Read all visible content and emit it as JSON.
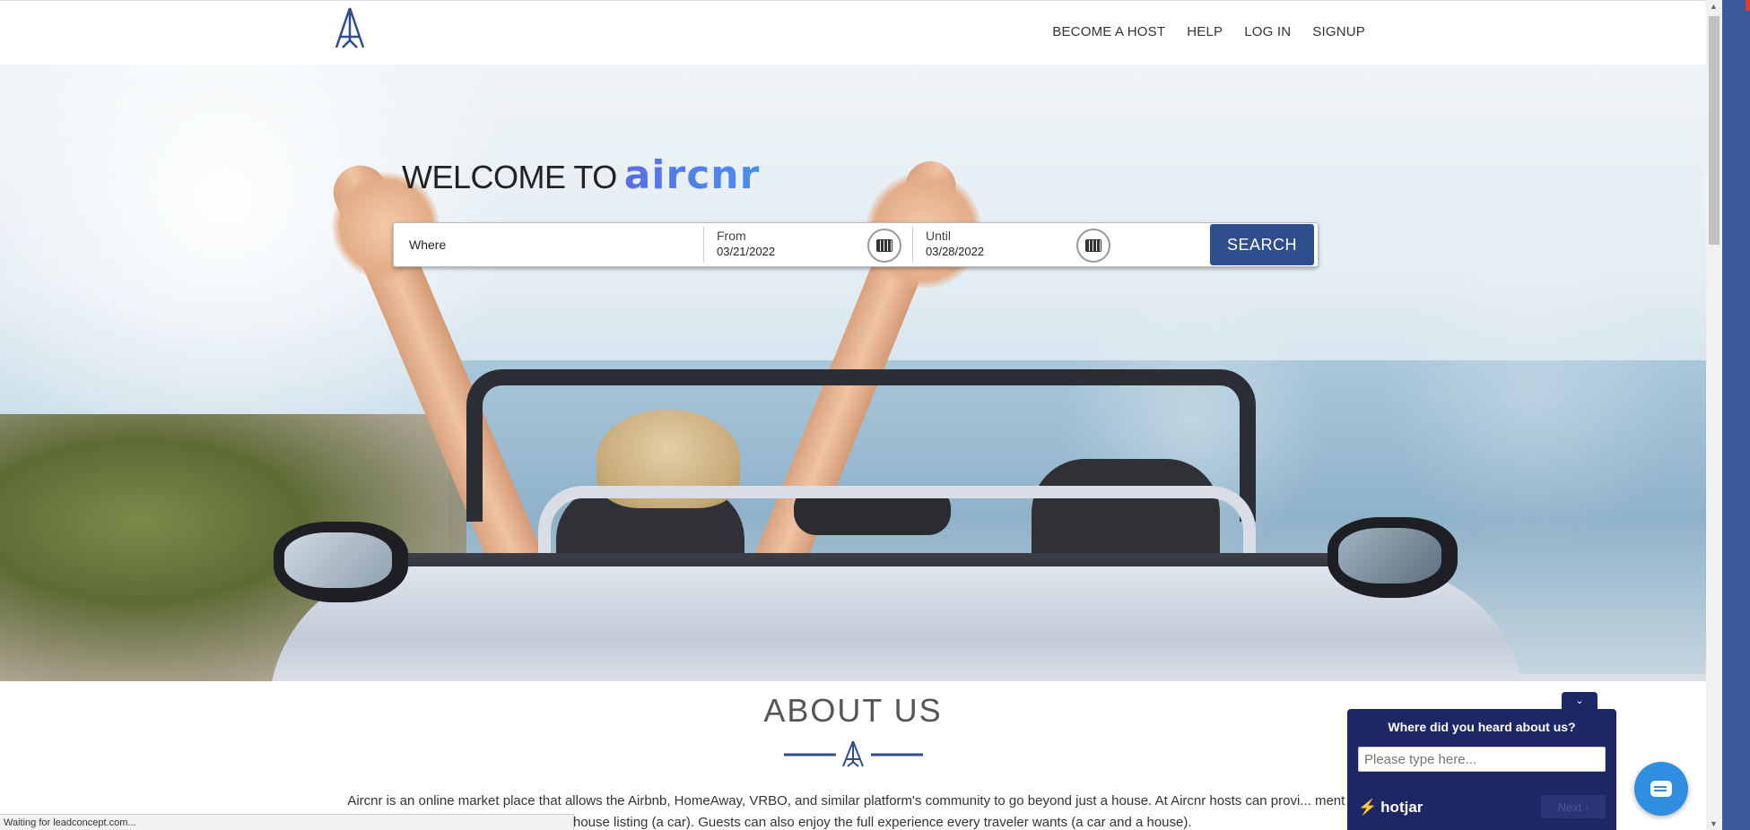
{
  "header": {
    "nav": [
      {
        "label": "BECOME A HOST"
      },
      {
        "label": "HELP"
      },
      {
        "label": "LOG IN"
      },
      {
        "label": "SIGNUP"
      }
    ]
  },
  "hero": {
    "welcome_prefix": "WELCOME TO",
    "brand": "aircnr",
    "search": {
      "where_placeholder": "Where",
      "from_label": "From",
      "from_value": "03/21/2022",
      "until_label": "Until",
      "until_value": "03/28/2022",
      "search_label": "SEARCH"
    }
  },
  "about": {
    "title": "ABOUT US",
    "text": "Aircnr is an online market place that allows the Airbnb, HomeAway, VRBO, and similar platform's community to go beyond just a house. At Aircnr hosts can provi... ment their Airbnb house listing (a car). Guests can also enjoy the full experience every traveler wants (a car and a house)."
  },
  "hotjar": {
    "question": "Where did you heard about us?",
    "placeholder": "Please type here...",
    "brand": "hotjar",
    "next_label": "Next",
    "collapse_icon": "chevron-down-icon"
  },
  "status": {
    "text": "Waiting for leadconcept.com..."
  },
  "colors": {
    "search_button": "#2d4d8c",
    "hotjar_bg": "#1d2765",
    "chat_button": "#2f8ee0",
    "brand_gradient_start": "#5b6ee1",
    "brand_gradient_end": "#4a8ff0"
  }
}
